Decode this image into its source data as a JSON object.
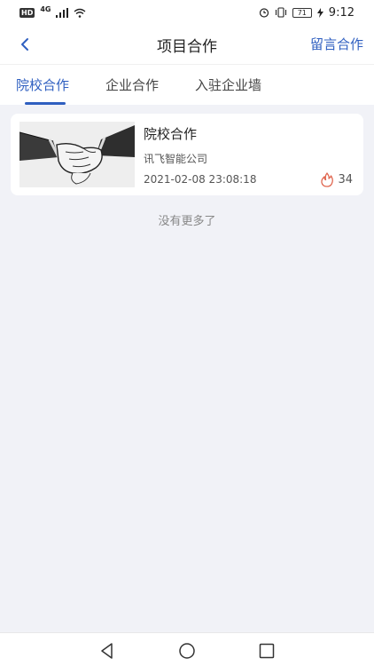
{
  "status_bar": {
    "hd": "HD",
    "network": "4G",
    "battery": "71",
    "time": "9:12",
    "icons": [
      "signal-icon",
      "wifi-icon",
      "alarm-icon",
      "vibrate-icon",
      "battery-icon",
      "charging-icon"
    ]
  },
  "nav": {
    "back_icon": "chevron-left-icon",
    "title": "项目合作",
    "action": "留言合作"
  },
  "tabs": [
    {
      "label": "院校合作",
      "active": true
    },
    {
      "label": "企业合作",
      "active": false
    },
    {
      "label": "入驻企业墙",
      "active": false
    }
  ],
  "list": {
    "items": [
      {
        "thumbnail": "handshake-image",
        "title": "院校合作",
        "company": "讯飞智能公司",
        "date": "2021-02-08 23:08:18",
        "heat_icon": "flame-icon",
        "heat_count": "34"
      }
    ],
    "end_text": "没有更多了"
  },
  "system_nav": [
    "back-triangle-icon",
    "home-circle-icon",
    "recents-square-icon"
  ],
  "colors": {
    "accent": "#2f5fc0",
    "background": "#f1f2f7",
    "flame": "#e0664f"
  }
}
